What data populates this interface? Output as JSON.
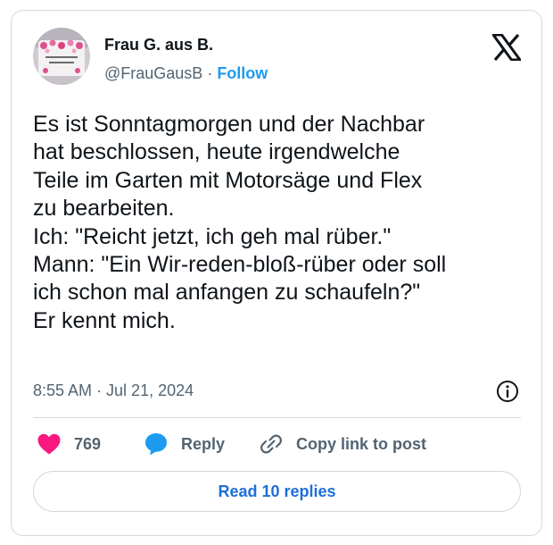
{
  "author": {
    "name": "Frau G. aus B.",
    "handle": "@FrauGausB",
    "separator": "·",
    "follow_label": "Follow"
  },
  "tweet": {
    "text": "Es ist Sonntagmorgen und der Nachbar\nhat beschlossen, heute irgendwelche\nTeile im Garten mit Motorsäge und Flex\nzu bearbeiten.\nIch: \"Reicht jetzt, ich geh mal rüber.\"\nMann: \"Ein Wir-reden-bloß-rüber oder soll\nich schon mal anfangen zu schaufeln?\"\nEr kennt mich.",
    "time": "8:55 AM",
    "separator": "·",
    "date": "Jul 21, 2024"
  },
  "actions": {
    "like_count": "769",
    "reply_label": "Reply",
    "copy_label": "Copy link to post"
  },
  "read_replies_label": "Read 10 replies",
  "icons": {
    "platform": "x-logo-icon",
    "info": "info-icon",
    "like": "heart-icon",
    "reply": "speech-bubble-icon",
    "copy": "link-icon"
  },
  "colors": {
    "accent": "#1d9bf0",
    "like": "#f91880",
    "secondary_text": "#536471",
    "border": "#cfd9de"
  }
}
